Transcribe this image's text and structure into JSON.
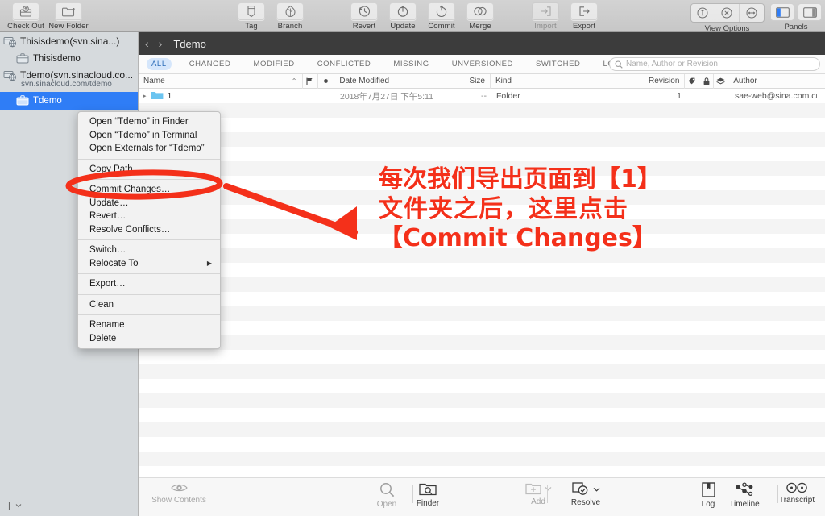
{
  "toolbar": {
    "left_items": [
      {
        "label": "Check Out",
        "icon": "check-out-icon",
        "disabled": false
      },
      {
        "label": "New Folder",
        "icon": "new-folder-icon",
        "disabled": false
      }
    ],
    "tag_branch_items": [
      {
        "label": "Tag",
        "icon": "tag-icon",
        "disabled": false
      },
      {
        "label": "Branch",
        "icon": "branch-icon",
        "disabled": false
      }
    ],
    "center_items": [
      {
        "label": "Revert",
        "icon": "revert-icon",
        "disabled": false
      },
      {
        "label": "Update",
        "icon": "update-icon",
        "disabled": false
      },
      {
        "label": "Commit",
        "icon": "commit-icon",
        "disabled": false
      },
      {
        "label": "Merge",
        "icon": "merge-icon",
        "disabled": false
      }
    ],
    "io_items": [
      {
        "label": "Import",
        "icon": "import-icon",
        "disabled": true
      },
      {
        "label": "Export",
        "icon": "export-icon",
        "disabled": false
      }
    ],
    "view_options_label": "View Options",
    "panels_label": "Panels"
  },
  "sidebar": {
    "items": [
      {
        "label": "Thisisdemo(svn.sina...)",
        "type": "repository",
        "icon": "repository-icon",
        "selected": false
      },
      {
        "label": "Thisisdemo",
        "type": "working-copy",
        "icon": "working-copy-icon",
        "selected": false
      },
      {
        "label": "Tdemo(svn.sinacloud.co...",
        "type": "repository",
        "icon": "repository-icon",
        "selected": false,
        "sublabel": "svn.sinacloud.com/tdemo"
      },
      {
        "label": "Tdemo",
        "type": "working-copy",
        "icon": "working-copy-icon",
        "selected": true
      }
    ],
    "add_button": "+"
  },
  "pathbar": {
    "back": "‹",
    "forward": "›",
    "title": "Tdemo"
  },
  "filters": [
    {
      "label": "ALL",
      "active": true
    },
    {
      "label": "CHANGED",
      "active": false
    },
    {
      "label": "MODIFIED",
      "active": false
    },
    {
      "label": "CONFLICTED",
      "active": false
    },
    {
      "label": "MISSING",
      "active": false
    },
    {
      "label": "UNVERSIONED",
      "active": false
    },
    {
      "label": "SWITCHED",
      "active": false
    },
    {
      "label": "LOCKED",
      "active": false
    }
  ],
  "search": {
    "placeholder": "Name, Author or Revision",
    "value": "",
    "icon": "search-icon"
  },
  "table": {
    "columns": [
      "Name",
      "Date Modified",
      "Size",
      "Kind",
      "Revision",
      "Author"
    ],
    "sort_indicator": "⌃",
    "flag_icons": [
      "flag-icon",
      "dot-icon"
    ],
    "attr_icons": [
      "tag-icon",
      "lock-icon",
      "stack-icon"
    ],
    "rows": [
      {
        "disclosure": "▸",
        "icon": "folder-icon",
        "name": "1",
        "date_modified": "2018年7月27日  下午5:11",
        "size": "--",
        "kind": "Folder",
        "revision": "1",
        "author": "sae-web@sina.com.cn"
      }
    ],
    "empty_row_count": 26
  },
  "context_menu": {
    "groups": [
      [
        {
          "label": "Open “Tdemo” in Finder"
        },
        {
          "label": "Open “Tdemo” in Terminal"
        },
        {
          "label": "Open Externals for “Tdemo”"
        }
      ],
      [
        {
          "label": "Copy Path"
        }
      ],
      [
        {
          "label": "Commit Changes…",
          "highlighted": true
        },
        {
          "label": "Update…"
        },
        {
          "label": "Revert…"
        },
        {
          "label": "Resolve Conflicts…"
        }
      ],
      [
        {
          "label": "Switch…"
        },
        {
          "label": "Relocate To",
          "submenu": true
        }
      ],
      [
        {
          "label": "Export…"
        }
      ],
      [
        {
          "label": "Clean"
        }
      ],
      [
        {
          "label": "Rename"
        },
        {
          "label": "Delete"
        }
      ]
    ]
  },
  "bottom_bar": {
    "left": [
      {
        "label": "Show Contents",
        "icon": "eye-icon",
        "disabled": true
      }
    ],
    "center": [
      {
        "label": "Open",
        "icon": "magnifier-icon",
        "disabled": true
      },
      {
        "label": "Finder",
        "icon": "finder-icon",
        "disabled": false
      },
      {
        "label": "Add",
        "icon": "add-folder-icon",
        "disabled": true,
        "has_chevron": true
      },
      {
        "label": "Resolve",
        "icon": "resolve-icon",
        "disabled": false,
        "has_chevron": true
      }
    ],
    "right": [
      {
        "label": "Log",
        "icon": "log-icon",
        "disabled": false
      },
      {
        "label": "Timeline",
        "icon": "timeline-icon",
        "disabled": false
      },
      {
        "label": "Transcript",
        "icon": "transcript-icon",
        "disabled": false
      }
    ]
  },
  "annotation": {
    "color": "#f4301a",
    "line1": "每次我们导出页面到【1】",
    "line2": "文件夹之后，这里点击",
    "line3": "【Commit Changes】",
    "ellipse_target": "Commit Changes…",
    "arrow": "red-arrow"
  }
}
